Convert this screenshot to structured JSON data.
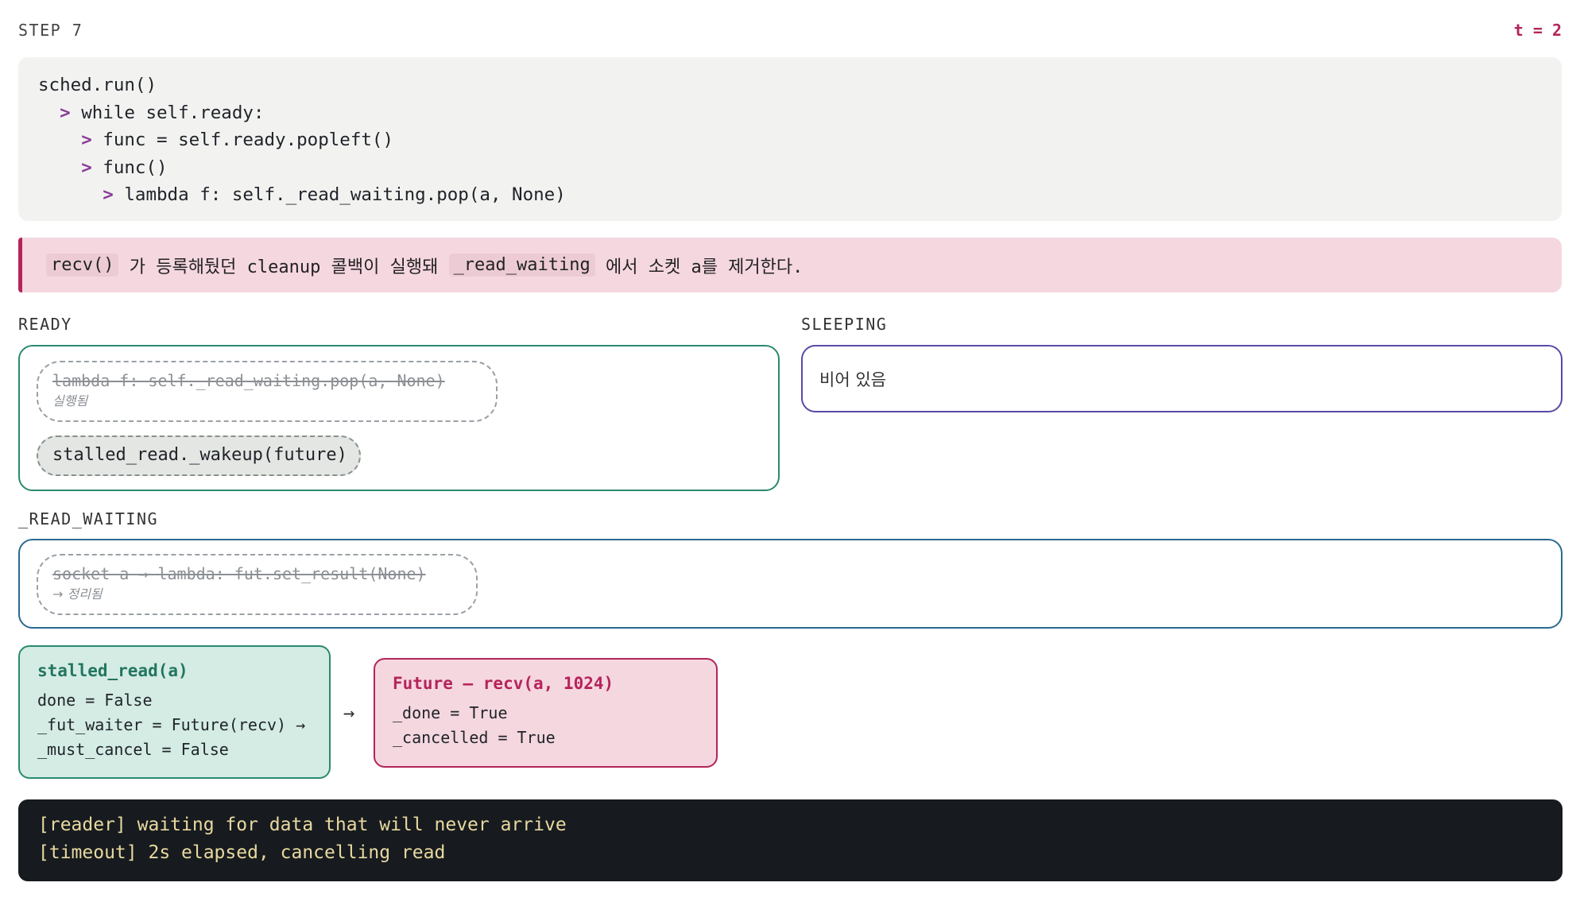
{
  "header": {
    "step": "STEP 7",
    "time": "t = 2"
  },
  "code": {
    "lines": [
      {
        "arrow": "",
        "text": "sched.run()"
      },
      {
        "arrow": "> ",
        "text": "while self.ready:"
      },
      {
        "arrow": "> ",
        "text": "func = self.ready.popleft()"
      },
      {
        "arrow": "> ",
        "text": "func()"
      },
      {
        "arrow": "> ",
        "text": "lambda f: self._read_waiting.pop(a, None)"
      }
    ]
  },
  "note": {
    "code1": "recv()",
    "text1": " 가 등록해뒀던 cleanup 콜백이 실행돼 ",
    "code2": "_read_waiting",
    "text2": " 에서 소켓 a를 제거한다."
  },
  "ready": {
    "label": "READY",
    "done_item": {
      "text": "lambda f: self._read_waiting.pop(a, None)",
      "status": "실행됨"
    },
    "active_item": {
      "text": "stalled_read._wakeup(future)"
    }
  },
  "sleeping": {
    "label": "SLEEPING",
    "empty_text": "비어 있음"
  },
  "read_waiting": {
    "label": "_READ_WAITING",
    "done_item": {
      "text": "socket a → lambda: fut.set_result(None)",
      "status": "→ 정리됨"
    }
  },
  "objects": {
    "task": {
      "title": "stalled_read(a)",
      "fields": [
        "done = False",
        "_fut_waiter = Future(recv) →",
        "_must_cancel = False"
      ]
    },
    "arrow": "→",
    "future": {
      "title": "Future — recv(a, 1024)",
      "fields": [
        "_done = True",
        "_cancelled = True"
      ]
    }
  },
  "console": {
    "lines": [
      "[reader] waiting for data that will never arrive",
      "[timeout] 2s elapsed, cancelling read"
    ]
  },
  "colors": {
    "accent_magenta": "#b5245a",
    "ready_border": "#2a8a70",
    "sleeping_border": "#5a4aa8",
    "read_waiting_border": "#2a6a90",
    "console_text": "#e8d9a0"
  }
}
